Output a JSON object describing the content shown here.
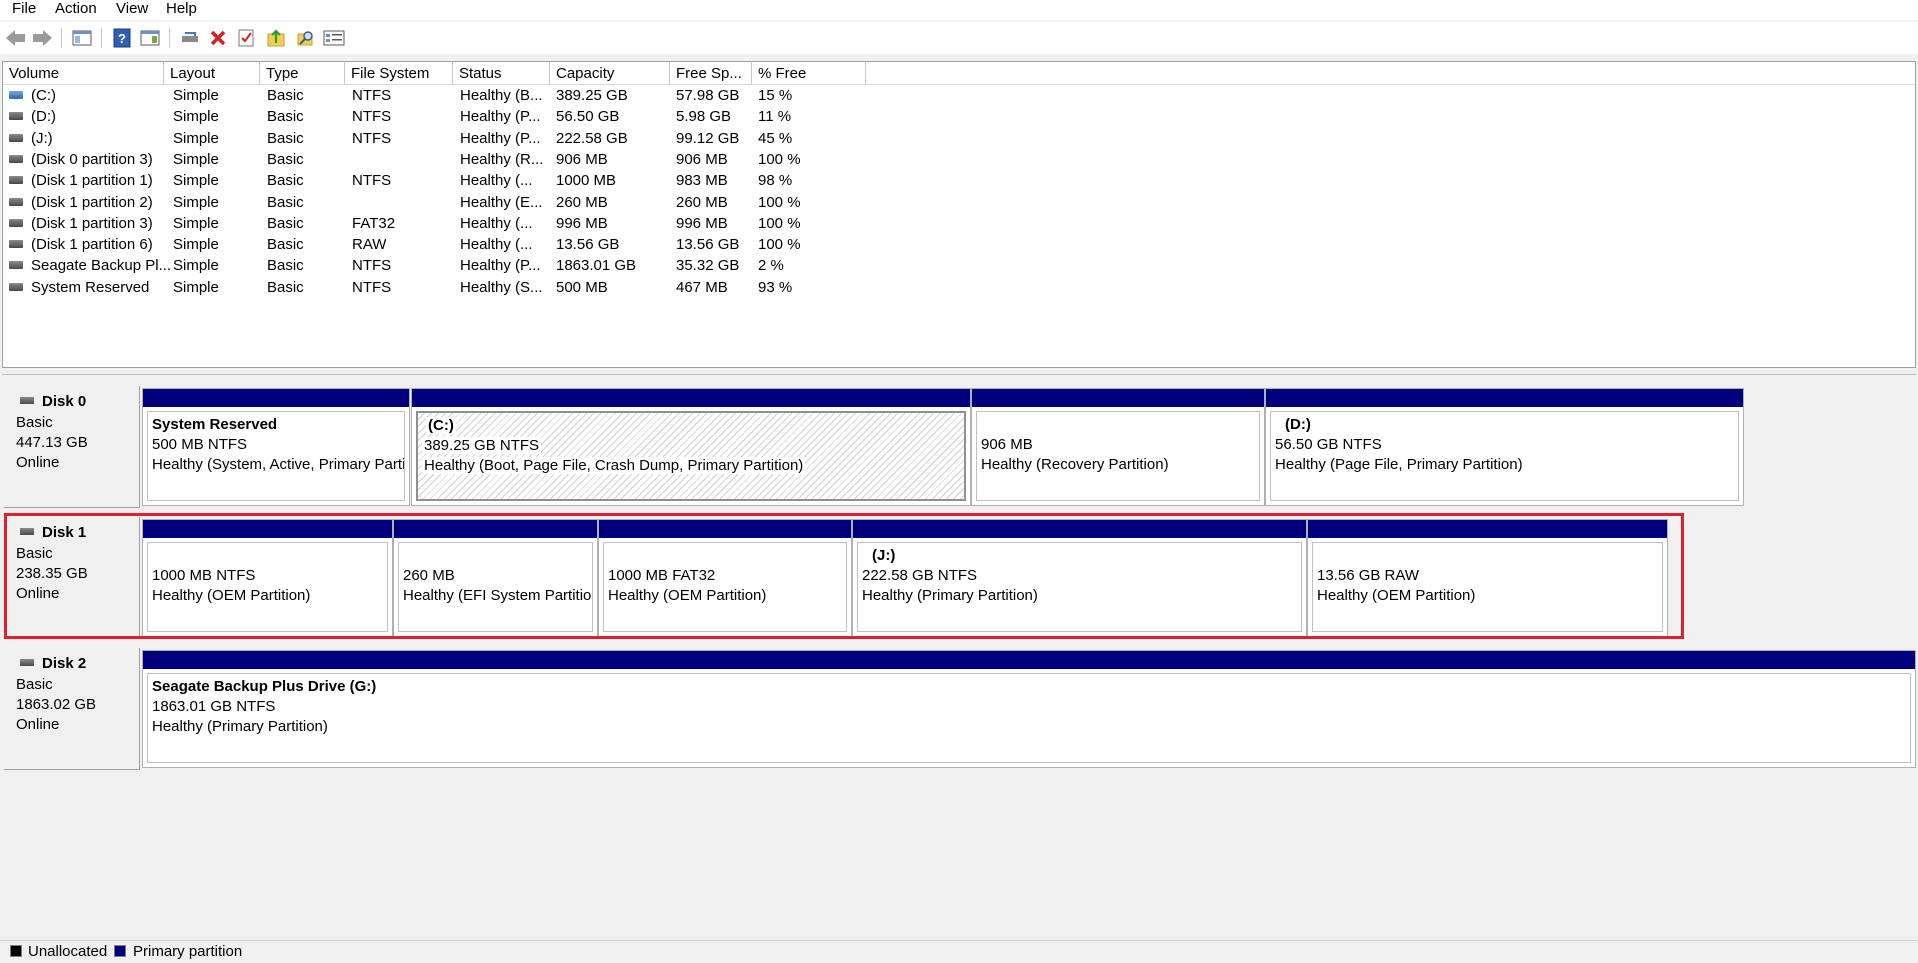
{
  "menu": [
    "File",
    "Action",
    "View",
    "Help"
  ],
  "toolbar": {
    "buttons": [
      "back-icon",
      "forward-icon",
      "show-hide-console-tree-icon",
      "help-icon",
      "show-action-pane-icon",
      "connect-drive-icon",
      "delete-icon",
      "check-icon",
      "up-folder-icon",
      "search-folder-icon",
      "properties-icon"
    ]
  },
  "volume_list": {
    "columns": [
      "Volume",
      "Layout",
      "Type",
      "File System",
      "Status",
      "Capacity",
      "Free Sp...",
      "% Free"
    ],
    "rows": [
      {
        "volume": "(C:)",
        "layout": "Simple",
        "type": "Basic",
        "fs": "NTFS",
        "status": "Healthy (B...",
        "capacity": "389.25 GB",
        "free": "57.98 GB",
        "pct": "15 %",
        "icon": "blue"
      },
      {
        "volume": "(D:)",
        "layout": "Simple",
        "type": "Basic",
        "fs": "NTFS",
        "status": "Healthy (P...",
        "capacity": "56.50 GB",
        "free": "5.98 GB",
        "pct": "11 %",
        "icon": "gray"
      },
      {
        "volume": "(J:)",
        "layout": "Simple",
        "type": "Basic",
        "fs": "NTFS",
        "status": "Healthy (P...",
        "capacity": "222.58 GB",
        "free": "99.12 GB",
        "pct": "45 %",
        "icon": "gray"
      },
      {
        "volume": "(Disk 0 partition 3)",
        "layout": "Simple",
        "type": "Basic",
        "fs": "",
        "status": "Healthy (R...",
        "capacity": "906 MB",
        "free": "906 MB",
        "pct": "100 %",
        "icon": "gray"
      },
      {
        "volume": "(Disk 1 partition 1)",
        "layout": "Simple",
        "type": "Basic",
        "fs": "NTFS",
        "status": "Healthy (...",
        "capacity": "1000 MB",
        "free": "983 MB",
        "pct": "98 %",
        "icon": "gray"
      },
      {
        "volume": "(Disk 1 partition 2)",
        "layout": "Simple",
        "type": "Basic",
        "fs": "",
        "status": "Healthy (E...",
        "capacity": "260 MB",
        "free": "260 MB",
        "pct": "100 %",
        "icon": "gray"
      },
      {
        "volume": "(Disk 1 partition 3)",
        "layout": "Simple",
        "type": "Basic",
        "fs": "FAT32",
        "status": "Healthy (...",
        "capacity": "996 MB",
        "free": "996 MB",
        "pct": "100 %",
        "icon": "gray"
      },
      {
        "volume": "(Disk 1 partition 6)",
        "layout": "Simple",
        "type": "Basic",
        "fs": "RAW",
        "status": "Healthy (...",
        "capacity": "13.56 GB",
        "free": "13.56 GB",
        "pct": "100 %",
        "icon": "gray"
      },
      {
        "volume": "Seagate Backup Pl...",
        "layout": "Simple",
        "type": "Basic",
        "fs": "NTFS",
        "status": "Healthy (P...",
        "capacity": "1863.01 GB",
        "free": "35.32 GB",
        "pct": "2 %",
        "icon": "gray"
      },
      {
        "volume": "System Reserved",
        "layout": "Simple",
        "type": "Basic",
        "fs": "NTFS",
        "status": "Healthy (S...",
        "capacity": "500 MB",
        "free": "467 MB",
        "pct": "93 %",
        "icon": "gray"
      }
    ]
  },
  "disks": [
    {
      "name": "Disk 0",
      "kind": "Basic",
      "size": "447.13 GB",
      "state": "Online",
      "partitions": [
        {
          "title": "System Reserved",
          "size": "500 MB NTFS",
          "status": "Healthy (System, Active, Primary Parti"
        },
        {
          "title": "(C:)",
          "size": "389.25 GB NTFS",
          "status": "Healthy (Boot, Page File, Crash Dump, Primary Partition)"
        },
        {
          "title": "",
          "size": "906 MB",
          "status": "Healthy (Recovery Partition)"
        },
        {
          "title": "(D:)",
          "size": "56.50 GB NTFS",
          "status": "Healthy (Page File, Primary Partition)"
        }
      ]
    },
    {
      "name": "Disk 1",
      "kind": "Basic",
      "size": "238.35 GB",
      "state": "Online",
      "partitions": [
        {
          "title": "",
          "size": "1000 MB NTFS",
          "status": "Healthy (OEM Partition)"
        },
        {
          "title": "",
          "size": "260 MB",
          "status": "Healthy (EFI System Partitio"
        },
        {
          "title": "",
          "size": "1000 MB FAT32",
          "status": "Healthy (OEM Partition)"
        },
        {
          "title": "(J:)",
          "size": "222.58 GB NTFS",
          "status": "Healthy (Primary Partition)"
        },
        {
          "title": "",
          "size": "13.56 GB RAW",
          "status": "Healthy (OEM Partition)"
        }
      ]
    },
    {
      "name": "Disk 2",
      "kind": "Basic",
      "size": "1863.02 GB",
      "state": "Online",
      "partitions": [
        {
          "title": "Seagate Backup Plus Drive  (G:)",
          "size": "1863.01 GB NTFS",
          "status": "Healthy (Primary Partition)"
        }
      ]
    }
  ],
  "legend": [
    {
      "label": "Unallocated",
      "color": "#000000"
    },
    {
      "label": "Primary partition",
      "color": "#00007f"
    }
  ],
  "colors": {
    "partition_bar": "#00007f",
    "highlight": "#e0202a"
  }
}
